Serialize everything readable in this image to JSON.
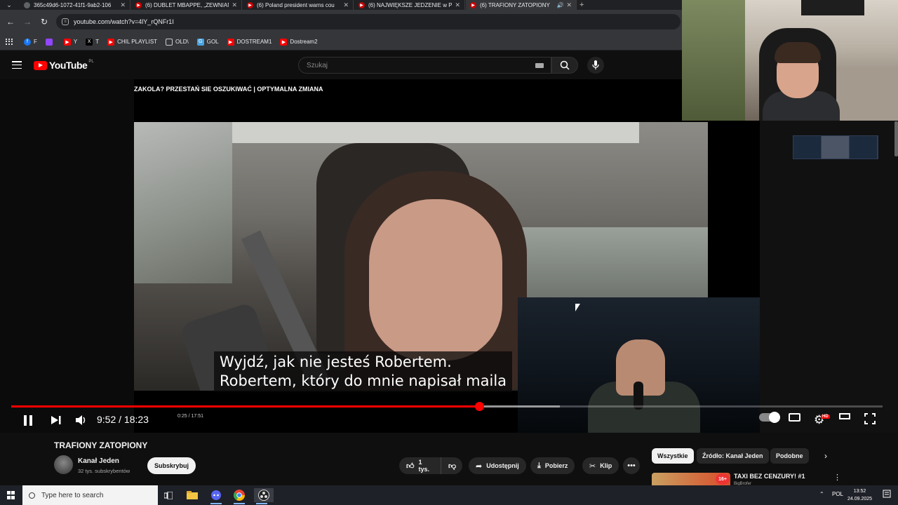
{
  "browser": {
    "tabs": [
      {
        "title": "365c49d6-1072-41f1-9ab2-106",
        "icon": "globe-icon",
        "active": false
      },
      {
        "title": "(6) DUBLET MBAPPE, „ZEWNIAN",
        "icon": "youtube-icon",
        "active": false
      },
      {
        "title": "(6) Poland president warns cou",
        "icon": "youtube-icon",
        "active": false
      },
      {
        "title": "(6) NAJWIĘKSZE JEDZENIE w PO",
        "icon": "youtube-icon",
        "active": false
      },
      {
        "title": "(6) TRAFIONY ZATOPIONY",
        "icon": "youtube-icon",
        "active": true
      }
    ],
    "url": "youtube.com/watch?v=4lY_rQNFr1I",
    "bookmarks": [
      {
        "label": "F",
        "color": "#1877f2"
      },
      {
        "label": "",
        "color": "#9146ff"
      },
      {
        "label": "Y",
        "color": "#ff0000"
      },
      {
        "label": "T",
        "color": "#000000"
      },
      {
        "label": "CHIL PLAYLIST",
        "color": "#ff0000"
      },
      {
        "label": "OLD\\",
        "color": "folder"
      },
      {
        "label": "GOL",
        "color": "#4aa3df"
      },
      {
        "label": "DOSTREAM1",
        "color": "#ff0000"
      },
      {
        "label": "Dostream2",
        "color": "#ff0000"
      }
    ]
  },
  "youtube": {
    "logo_text": "YouTube",
    "logo_country": "PL",
    "search_placeholder": "Szukaj"
  },
  "player": {
    "ticker": "ZAKOLA?  PRZESTAŃ SIE OSZUKIWAĆ  | OPTYMALNA ZMIANA",
    "subtitle_line1": "Wyjdź, jak nie jesteś Robertem.",
    "subtitle_line2": "Robertem, który do mnie napisał maila",
    "time_display": "9:52 / 18:23",
    "inner_time": "0:25 / 17:51",
    "progress_fraction": 0.537,
    "buffer_fraction": 0.63,
    "hd_badge": "HD",
    "accent_color": "#ff0000"
  },
  "video_info": {
    "title": "TRAFIONY ZATOPIONY",
    "channel_name": "Kanał Jeden",
    "channel_subs": "32 tys. subskrybentów",
    "subscribe_label": "Subskrybuj",
    "like_label": "1 tys.",
    "share_label": "Udostępnij",
    "download_label": "Pobierz",
    "clip_label": "Klip"
  },
  "sidebar": {
    "chips": [
      "Wszystkie",
      "Źródło: Kanał Jeden",
      "Podobne"
    ],
    "rec_title": "TAXI BEZ CENZURY! #1",
    "rec_channel": "BigBrofer",
    "rec_badge": "16+"
  },
  "taskbar": {
    "search_placeholder": "Type here to search",
    "language": "POL",
    "time": "13:52",
    "date": "24.09.2025"
  }
}
